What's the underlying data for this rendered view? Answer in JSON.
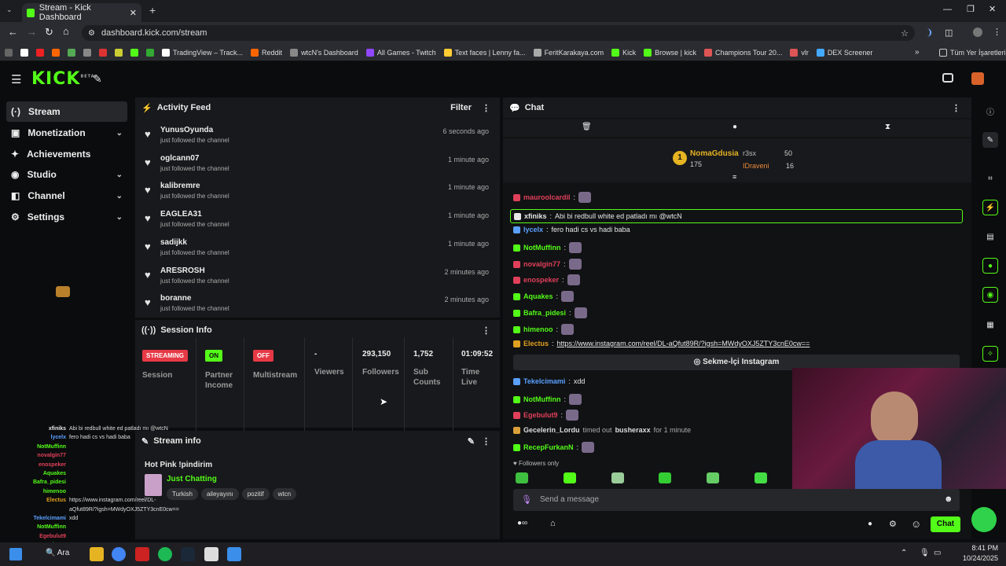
{
  "browser": {
    "tab_title": "Stream - Kick Dashboard",
    "url": "dashboard.kick.com/stream",
    "bookmarks": [
      "TradingView – Track...",
      "Reddit",
      "wtcN's Dashboard",
      "All Games - Twitch",
      "Text faces | Lenny fa...",
      "FeritKarakaya.com",
      "Kick",
      "Browse | kick",
      "Champions Tour 20...",
      "vlr",
      "DEX Screener"
    ],
    "all_bookmarks": "Tüm Yer İşaretleri"
  },
  "app": {
    "logo": "KICK",
    "logo_beta": "BETA"
  },
  "sidebar": {
    "items": [
      {
        "label": "Stream"
      },
      {
        "label": "Monetization"
      },
      {
        "label": "Achievements"
      },
      {
        "label": "Studio"
      },
      {
        "label": "Channel"
      },
      {
        "label": "Settings"
      }
    ]
  },
  "activity": {
    "title": "Activity Feed",
    "filter": "Filter",
    "items": [
      {
        "name": "YunusOyunda",
        "sub": "just followed the channel",
        "time": "6 seconds ago"
      },
      {
        "name": "oglcann07",
        "sub": "just followed the channel",
        "time": "1 minute ago"
      },
      {
        "name": "kalibremre",
        "sub": "just followed the channel",
        "time": "1 minute ago"
      },
      {
        "name": "EAGLEA31",
        "sub": "just followed the channel",
        "time": "1 minute ago"
      },
      {
        "name": "sadijkk",
        "sub": "just followed the channel",
        "time": "1 minute ago"
      },
      {
        "name": "ARESROSH",
        "sub": "just followed the channel",
        "time": "2 minutes ago"
      },
      {
        "name": "boranne",
        "sub": "just followed the channel",
        "time": "2 minutes ago"
      }
    ]
  },
  "session": {
    "title": "Session Info",
    "streaming": "STREAMING",
    "session_label": "Session",
    "partner_badge": "ON",
    "partner_label_1": "Partner",
    "partner_label_2": "Income",
    "multistream_badge": "OFF",
    "multistream_label": "Multistream",
    "viewers": "-",
    "viewers_label": "Viewers",
    "followers": "293,150",
    "followers_label": "Followers",
    "subs": "1,752",
    "subs_label_1": "Sub",
    "subs_label_2": "Counts",
    "time": "01:09:52",
    "time_label_1": "Time",
    "time_label_2": "Live"
  },
  "streaminfo": {
    "title": "Stream info",
    "stream_title": "Hot Pink !pindirim",
    "category": "Just Chatting",
    "tags": [
      "Turkish",
      "aileyayını",
      "pozitif",
      "wtcn"
    ]
  },
  "chat": {
    "title": "Chat",
    "top1_rank": "1",
    "top1_name": "NomaGdusia",
    "top1_val": "175",
    "top2_name": "r3sx",
    "top2_val": "50",
    "top3_name": "IDraveni",
    "top3_val": "16",
    "messages": [
      {
        "user": "mauroolcardil",
        "text": "",
        "color": "#e0405a"
      },
      {
        "user": "xfiniks",
        "text": "Abi bi redbull white ed patladı mı @wtcN",
        "color": "#e8e8e8"
      },
      {
        "user": "lycelx",
        "text": "fero hadi cs vs hadi baba",
        "color": "#5aa0ff"
      },
      {
        "user": "NotMuffinn",
        "text": "",
        "color": "#53fc18"
      },
      {
        "user": "novalgin77",
        "text": "",
        "color": "#e0405a"
      },
      {
        "user": "enospeker",
        "text": "",
        "color": "#e0405a"
      },
      {
        "user": "Aquakes",
        "text": "",
        "color": "#53fc18"
      },
      {
        "user": "Bafra_pidesi",
        "text": "",
        "color": "#53fc18"
      },
      {
        "user": "himenoo",
        "text": "",
        "color": "#53fc18"
      },
      {
        "user": "Electus",
        "text": "https://www.instagram.com/reel/DL-aQfut89R/?igsh=MWdyOXJ5ZTY3cnE0cw==",
        "color": "#e0a020"
      },
      {
        "user": "Tekelcimami",
        "text": "xdd",
        "color": "#5aa0ff"
      },
      {
        "user": "NotMuffinn",
        "text": "",
        "color": "#53fc18"
      },
      {
        "user": "Egebulut9",
        "text": "",
        "color": "#e0405a"
      },
      {
        "user": "RecepFurkanN",
        "text": "",
        "color": "#53fc18"
      }
    ],
    "embed": "Sekme-İçi Instagram",
    "timeout": {
      "actor": "Gecelerin_Lordu",
      "text": "timed out",
      "target": "busheraxx",
      "dur": "for 1 minute"
    },
    "followers_only": "Followers only",
    "placeholder": "Send a message",
    "send": "Chat"
  },
  "overlay": [
    {
      "n": "xfiniks",
      "t": "Abi bi redbull white ed patladı mı @wtcN",
      "c": "#e8e8e8"
    },
    {
      "n": "lycelx",
      "t": "fero hadi cs vs hadi baba",
      "c": "#5aa0ff"
    },
    {
      "n": "NotMuffinn",
      "t": "",
      "c": "#53fc18"
    },
    {
      "n": "novalgin77",
      "t": "",
      "c": "#e0405a"
    },
    {
      "n": "enospeker",
      "t": "",
      "c": "#e0405a"
    },
    {
      "n": "Aquakes",
      "t": "",
      "c": "#53fc18"
    },
    {
      "n": "Bafra_pidesi",
      "t": "",
      "c": "#53fc18"
    },
    {
      "n": "himenoo",
      "t": "",
      "c": "#53fc18"
    },
    {
      "n": "Electus",
      "t": "https://www.instagram.com/reel/DL-",
      "c": "#e0a020"
    },
    {
      "n": "",
      "t": "aQfut89R/?igsh=MWdyOXJ5ZTY3cnE0cw==",
      "c": "#e0a020"
    },
    {
      "n": "Tekelcimami",
      "t": "xdd",
      "c": "#5aa0ff"
    },
    {
      "n": "NotMuffinn",
      "t": "",
      "c": "#53fc18"
    },
    {
      "n": "Egebulut9",
      "t": "",
      "c": "#e0405a"
    },
    {
      "n": "RecepFurkanN",
      "t": "",
      "c": "#53fc18"
    }
  ],
  "taskbar": {
    "search": "Ara",
    "time": "8:41 PM",
    "date": "10/24/2025"
  },
  "colors": {
    "accent": "#53fc18",
    "panel": "#18191c",
    "bg": "#0b0c0d"
  }
}
